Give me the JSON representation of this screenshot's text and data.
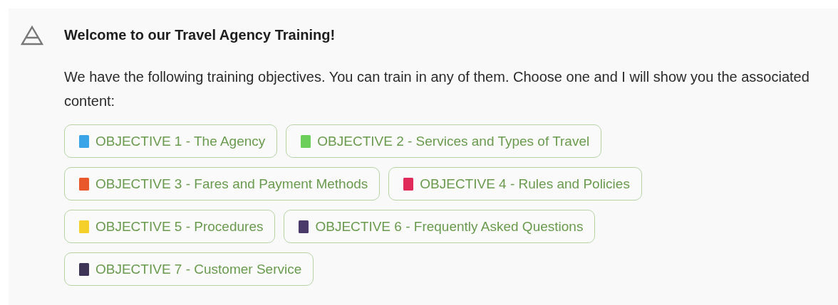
{
  "message": {
    "title": "Welcome to our Travel Agency Training!",
    "text": "We have the following training objectives. You can train in any of them. Choose one and I will show you the associated content:",
    "options": [
      {
        "label": "OBJECTIVE 1 - The Agency",
        "color": "#3aa4e8"
      },
      {
        "label": "OBJECTIVE 2 - Services and Types of Travel",
        "color": "#6ccf5a"
      },
      {
        "label": "OBJECTIVE 3 - Fares and Payment Methods",
        "color": "#e8582a"
      },
      {
        "label": "OBJECTIVE 4 - Rules and Policies",
        "color": "#e02a5a"
      },
      {
        "label": "OBJECTIVE 5 - Procedures",
        "color": "#f5cf2a"
      },
      {
        "label": "OBJECTIVE 6 - Frequently Asked Questions",
        "color": "#4a3a6a"
      },
      {
        "label": "OBJECTIVE 7 - Customer Service",
        "color": "#3e3458"
      }
    ]
  }
}
